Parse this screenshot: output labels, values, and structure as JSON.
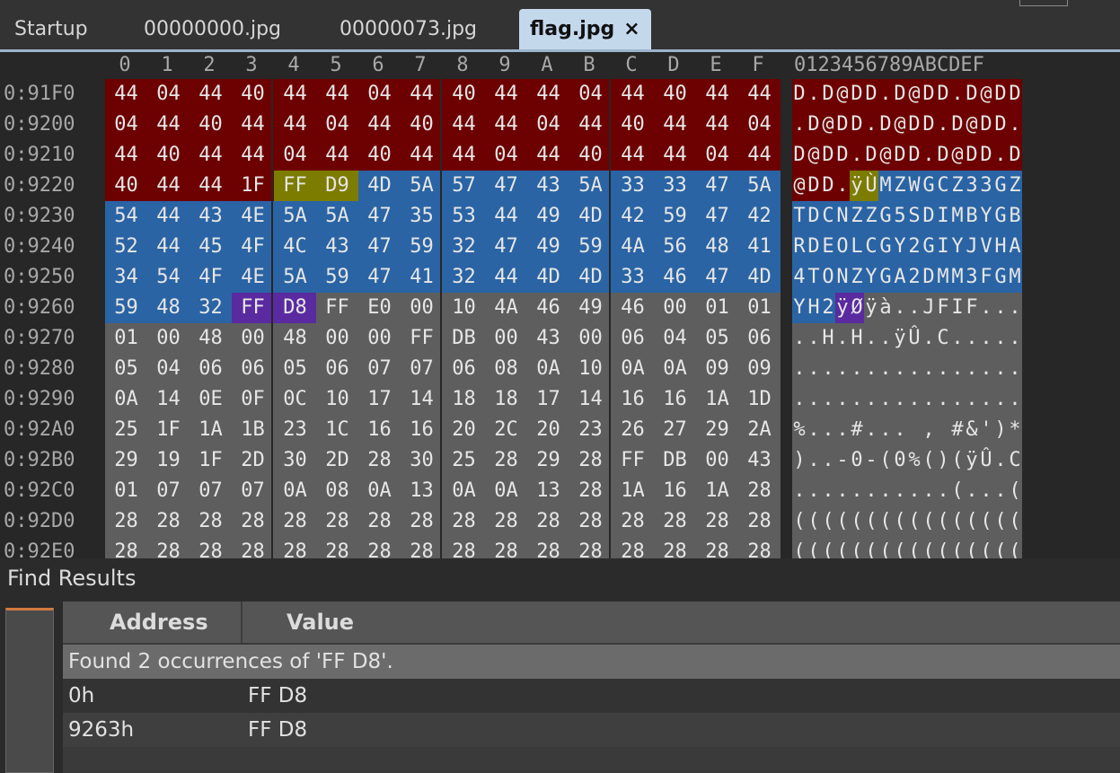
{
  "tabs": [
    {
      "label": "Startup",
      "active": false
    },
    {
      "label": "00000000.jpg",
      "active": false
    },
    {
      "label": "00000073.jpg",
      "active": false
    },
    {
      "label": "flag.jpg",
      "active": true,
      "close_glyph": "×"
    }
  ],
  "hex": {
    "columns": [
      "0",
      "1",
      "2",
      "3",
      "4",
      "5",
      "6",
      "7",
      "8",
      "9",
      "A",
      "B",
      "C",
      "D",
      "E",
      "F"
    ],
    "ascii_header": "0123456789ABCDEF",
    "caret_glyph": "ˇ",
    "colors": {
      "red": "#6d0000",
      "blue": "#2a64a4",
      "gray": "#5e5e5e",
      "olive": "#7c7c00",
      "purple": "#5a2aa0"
    },
    "rows": [
      {
        "addr": "0:91F0",
        "bytes": [
          "44",
          "04",
          "44",
          "40",
          "44",
          "44",
          "04",
          "44",
          "40",
          "44",
          "44",
          "04",
          "44",
          "40",
          "44",
          "44"
        ],
        "ascii": "D.D@DD.D@DD.D@DD",
        "colors": "rrrrrrrrrrrrrrrr"
      },
      {
        "addr": "0:9200",
        "bytes": [
          "04",
          "44",
          "40",
          "44",
          "44",
          "04",
          "44",
          "40",
          "44",
          "44",
          "04",
          "44",
          "40",
          "44",
          "44",
          "04"
        ],
        "ascii": ".D@DD.D@DD.D@DD.",
        "colors": "rrrrrrrrrrrrrrrr"
      },
      {
        "addr": "0:9210",
        "bytes": [
          "44",
          "40",
          "44",
          "44",
          "04",
          "44",
          "40",
          "44",
          "44",
          "04",
          "44",
          "40",
          "44",
          "44",
          "04",
          "44"
        ],
        "ascii": "D@DD.D@DD.D@DD.D",
        "colors": "rrrrrrrrrrrrrrrr"
      },
      {
        "addr": "0:9220",
        "bytes": [
          "40",
          "44",
          "44",
          "1F",
          "FF",
          "D9",
          "4D",
          "5A",
          "57",
          "47",
          "43",
          "5A",
          "33",
          "33",
          "47",
          "5A"
        ],
        "ascii": "@DD.ÿÙMZWGCZ33GZ",
        "colors": "rrrryybbbbbbbbbb"
      },
      {
        "addr": "0:9230",
        "bytes": [
          "54",
          "44",
          "43",
          "4E",
          "5A",
          "5A",
          "47",
          "35",
          "53",
          "44",
          "49",
          "4D",
          "42",
          "59",
          "47",
          "42"
        ],
        "ascii": "TDCNZZG5SDIMBYGB",
        "colors": "bbbbbbbbbbbbbbbb"
      },
      {
        "addr": "0:9240",
        "bytes": [
          "52",
          "44",
          "45",
          "4F",
          "4C",
          "43",
          "47",
          "59",
          "32",
          "47",
          "49",
          "59",
          "4A",
          "56",
          "48",
          "41"
        ],
        "ascii": "RDEOLCGY2GIYJVHA",
        "colors": "bbbbbbbbbbbbbbbb"
      },
      {
        "addr": "0:9250",
        "bytes": [
          "34",
          "54",
          "4F",
          "4E",
          "5A",
          "59",
          "47",
          "41",
          "32",
          "44",
          "4D",
          "4D",
          "33",
          "46",
          "47",
          "4D"
        ],
        "ascii": "4TONZYGA2DMM3FGM",
        "colors": "bbbbbbbbbbbbbbbb"
      },
      {
        "addr": "0:9260",
        "bytes": [
          "59",
          "48",
          "32",
          "FF",
          "D8",
          "FF",
          "E0",
          "00",
          "10",
          "4A",
          "46",
          "49",
          "46",
          "00",
          "01",
          "01"
        ],
        "ascii": "YH2ÿØÿà..JFIF...",
        "colors": "bbbppggggggggggg"
      },
      {
        "addr": "0:9270",
        "bytes": [
          "01",
          "00",
          "48",
          "00",
          "48",
          "00",
          "00",
          "FF",
          "DB",
          "00",
          "43",
          "00",
          "06",
          "04",
          "05",
          "06"
        ],
        "ascii": "..H.H..ÿÛ.C.....",
        "colors": "gggggggggggggggg"
      },
      {
        "addr": "0:9280",
        "bytes": [
          "05",
          "04",
          "06",
          "06",
          "05",
          "06",
          "07",
          "07",
          "06",
          "08",
          "0A",
          "10",
          "0A",
          "0A",
          "09",
          "09"
        ],
        "ascii": "................",
        "colors": "gggggggggggggggg"
      },
      {
        "addr": "0:9290",
        "bytes": [
          "0A",
          "14",
          "0E",
          "0F",
          "0C",
          "10",
          "17",
          "14",
          "18",
          "18",
          "17",
          "14",
          "16",
          "16",
          "1A",
          "1D"
        ],
        "ascii": "................",
        "colors": "gggggggggggggggg"
      },
      {
        "addr": "0:92A0",
        "bytes": [
          "25",
          "1F",
          "1A",
          "1B",
          "23",
          "1C",
          "16",
          "16",
          "20",
          "2C",
          "20",
          "23",
          "26",
          "27",
          "29",
          "2A"
        ],
        "ascii": "%...#... , #&')*",
        "colors": "gggggggggggggggg"
      },
      {
        "addr": "0:92B0",
        "bytes": [
          "29",
          "19",
          "1F",
          "2D",
          "30",
          "2D",
          "28",
          "30",
          "25",
          "28",
          "29",
          "28",
          "FF",
          "DB",
          "00",
          "43"
        ],
        "ascii": ")..-0-(0%()(ÿÛ.C",
        "colors": "gggggggggggggggg"
      },
      {
        "addr": "0:92C0",
        "bytes": [
          "01",
          "07",
          "07",
          "07",
          "0A",
          "08",
          "0A",
          "13",
          "0A",
          "0A",
          "13",
          "28",
          "1A",
          "16",
          "1A",
          "28"
        ],
        "ascii": "...........(...(",
        "colors": "gggggggggggggggg"
      },
      {
        "addr": "0:92D0",
        "bytes": [
          "28",
          "28",
          "28",
          "28",
          "28",
          "28",
          "28",
          "28",
          "28",
          "28",
          "28",
          "28",
          "28",
          "28",
          "28",
          "28"
        ],
        "ascii": "((((((((((((((((",
        "colors": "gggggggggggggggg"
      },
      {
        "addr": "0:92E0",
        "bytes": [
          "28",
          "28",
          "28",
          "28",
          "28",
          "28",
          "28",
          "28",
          "28",
          "28",
          "28",
          "28",
          "28",
          "28",
          "28",
          "28"
        ],
        "ascii": "((((((((((((((((",
        "colors": "gggggggggggggggg"
      }
    ]
  },
  "find": {
    "title": "Find Results",
    "headers": {
      "address": "Address",
      "value": "Value"
    },
    "summary": "Found 2 occurrences of 'FF D8'.",
    "results": [
      {
        "address": "0h",
        "value": "FF D8"
      },
      {
        "address": "9263h",
        "value": "FF D8"
      }
    ]
  }
}
